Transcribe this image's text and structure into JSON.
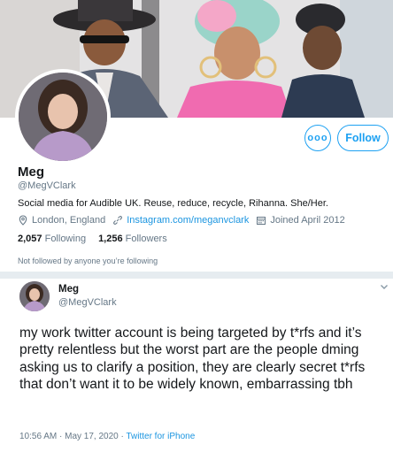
{
  "profile": {
    "name": "Meg",
    "handle": "@MegVClark",
    "bio": "Social media for Audible UK. Reuse, reduce, recycle, Rihanna. She/Her.",
    "location": "London, England",
    "website": "Instagram.com/meganvclark",
    "joined": "Joined April 2012",
    "following_count": "2,057",
    "following_label": "Following",
    "followers_count": "1,256",
    "followers_label": "Followers",
    "not_followed": "Not followed by anyone you’re following",
    "more_label": "ooo",
    "follow_label": "Follow"
  },
  "tweet": {
    "name": "Meg",
    "handle": "@MegVClark",
    "text": "my work twitter account is being targeted by t*rfs and it’s pretty relentless but the worst part are the people dming asking us to clarify a position, they are clearly secret t*rfs that don’t want it to be widely known, embarrassing tbh",
    "timestamp": "10:56 AM · May 17, 2020 · ",
    "source": "Twitter for iPhone"
  },
  "colors": {
    "accent": "#1da1f2",
    "link": "#1b95e0",
    "muted": "#657786",
    "divider": "#e6ecf0"
  },
  "icons": {
    "location": "location-pin-icon",
    "website": "link-icon",
    "joined": "calendar-icon",
    "more": "more-dots-icon",
    "caret": "chevron-down-icon"
  }
}
